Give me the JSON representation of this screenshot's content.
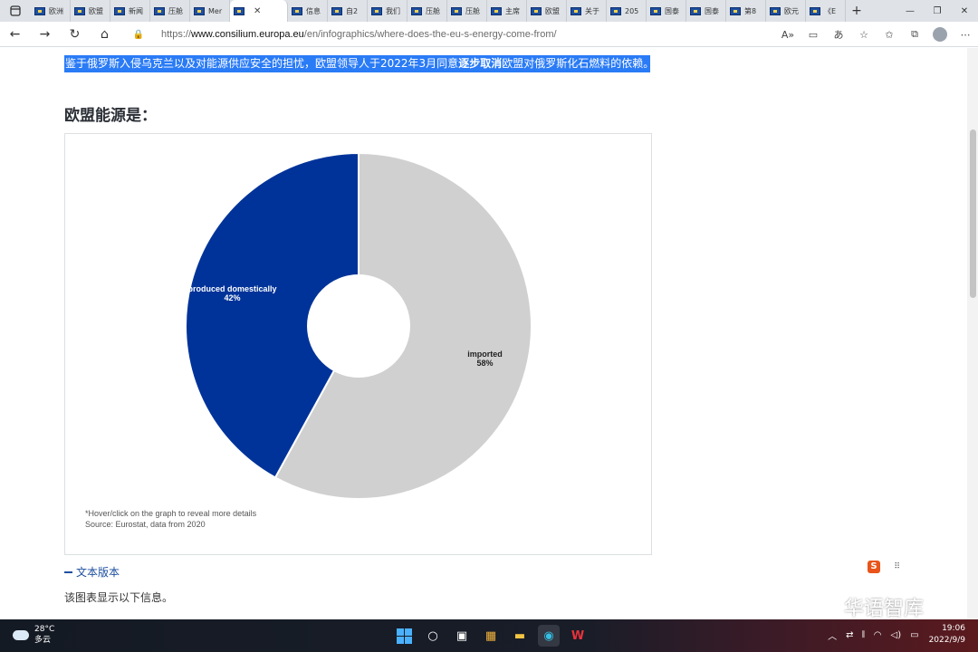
{
  "browser": {
    "tabs": [
      {
        "label": "欧洲"
      },
      {
        "label": "欧盟"
      },
      {
        "label": "新闻"
      },
      {
        "label": "压舱"
      },
      {
        "label": "Mer"
      },
      {
        "label": ""
      },
      {
        "label": "信息"
      },
      {
        "label": "自2"
      },
      {
        "label": "我们"
      },
      {
        "label": "压舱"
      },
      {
        "label": "压舱"
      },
      {
        "label": "主席"
      },
      {
        "label": "欧盟"
      },
      {
        "label": "关于"
      },
      {
        "label": "205"
      },
      {
        "label": "国泰"
      },
      {
        "label": "国泰"
      },
      {
        "label": "第8"
      },
      {
        "label": "欧元"
      },
      {
        "label": "《E"
      }
    ],
    "new_tab_label": "+",
    "url_prefix": "https://",
    "url_domain": "www.consilium.europa.eu",
    "url_path": "/en/infographics/where-does-the-eu-s-energy-come-from/"
  },
  "page": {
    "highlight_pre": "鉴于俄罗斯入侵乌克兰以及对能源供应安全的担忧，欧盟领导人于2022年3月同意",
    "highlight_bold": "逐步取消",
    "highlight_post": "欧盟对俄罗斯化石燃料的依赖。",
    "section_title": "欧盟能源是：",
    "note_line1": "*Hover/click on the graph to reveal more details",
    "note_line2": "Source: Eurostat, data from 2020",
    "text_version_label": "文本版本",
    "description": "该图表显示以下信息。"
  },
  "chart_data": {
    "type": "pie",
    "donut": true,
    "slices": [
      {
        "label": "produced domestically",
        "value": 42,
        "display": "42%",
        "color": "#003399"
      },
      {
        "label": "imported",
        "value": 58,
        "display": "58%",
        "color": "#d0d0d0"
      }
    ]
  },
  "taskbar": {
    "temperature": "28°C",
    "weather_desc": "多云",
    "time": "19:06",
    "date": "2022/9/9"
  },
  "watermark": {
    "text": "华语智库"
  }
}
